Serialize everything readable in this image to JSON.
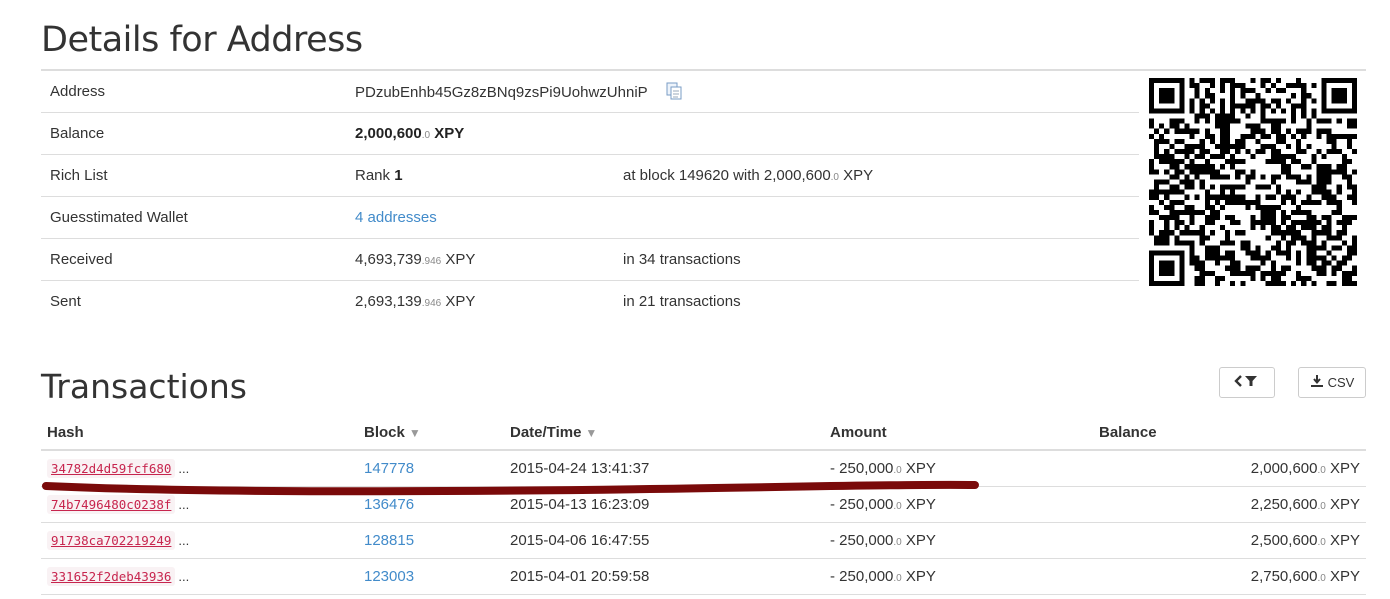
{
  "details": {
    "title": "Details for Address",
    "address_label": "Address",
    "address_value": "PDzubEnhb45Gz8zBNq9zsPi9UohwzUhniP",
    "balance_label": "Balance",
    "balance_main": "2,000,600",
    "balance_frac": ".0",
    "balance_unit": "XPY",
    "rich_label": "Rich List",
    "rank_prefix": "Rank",
    "rank_value": "1",
    "rich_info_main": "at block 149620 with 2,000,600",
    "rich_info_frac": ".0",
    "rich_info_unit": "XPY",
    "wallet_label": "Guesstimated Wallet",
    "wallet_link": "4 addresses",
    "received_label": "Received",
    "received_main": "4,693,739",
    "received_frac": ".946",
    "received_unit": "XPY",
    "received_info": "in 34 transactions",
    "sent_label": "Sent",
    "sent_main": "2,693,139",
    "sent_frac": ".946",
    "sent_unit": "XPY",
    "sent_info": "in 21 transactions"
  },
  "transactions": {
    "title": "Transactions",
    "csv_label": "CSV",
    "headers": {
      "hash": "Hash",
      "block": "Block",
      "datetime": "Date/Time",
      "amount": "Amount",
      "balance": "Balance"
    },
    "rows": [
      {
        "hash": "34782d4d59fcf680",
        "block": "147778",
        "datetime": "2015-04-24 13:41:37",
        "amount_main": "- 250,000",
        "amount_frac": ".0",
        "unit": "XPY",
        "balance_main": "2,000,600",
        "balance_frac": ".0"
      },
      {
        "hash": "74b7496480c0238f",
        "block": "136476",
        "datetime": "2015-04-13 16:23:09",
        "amount_main": "- 250,000",
        "amount_frac": ".0",
        "unit": "XPY",
        "balance_main": "2,250,600",
        "balance_frac": ".0"
      },
      {
        "hash": "91738ca702219249",
        "block": "128815",
        "datetime": "2015-04-06 16:47:55",
        "amount_main": "- 250,000",
        "amount_frac": ".0",
        "unit": "XPY",
        "balance_main": "2,500,600",
        "balance_frac": ".0"
      },
      {
        "hash": "331652f2deb43936",
        "block": "123003",
        "datetime": "2015-04-01 20:59:58",
        "amount_main": "- 250,000",
        "amount_frac": ".0",
        "unit": "XPY",
        "balance_main": "2,750,600",
        "balance_frac": ".0"
      }
    ],
    "ellipsis": "..."
  },
  "colors": {
    "link": "#428bca",
    "hash_text": "#c7254e",
    "hash_bg": "#f9f2f4",
    "annotation_stroke": "#7a0a0a"
  },
  "icons": {
    "copy": "copy-icon",
    "filter": "filter-icon",
    "download": "download-icon",
    "sort": "sort-down-icon"
  }
}
